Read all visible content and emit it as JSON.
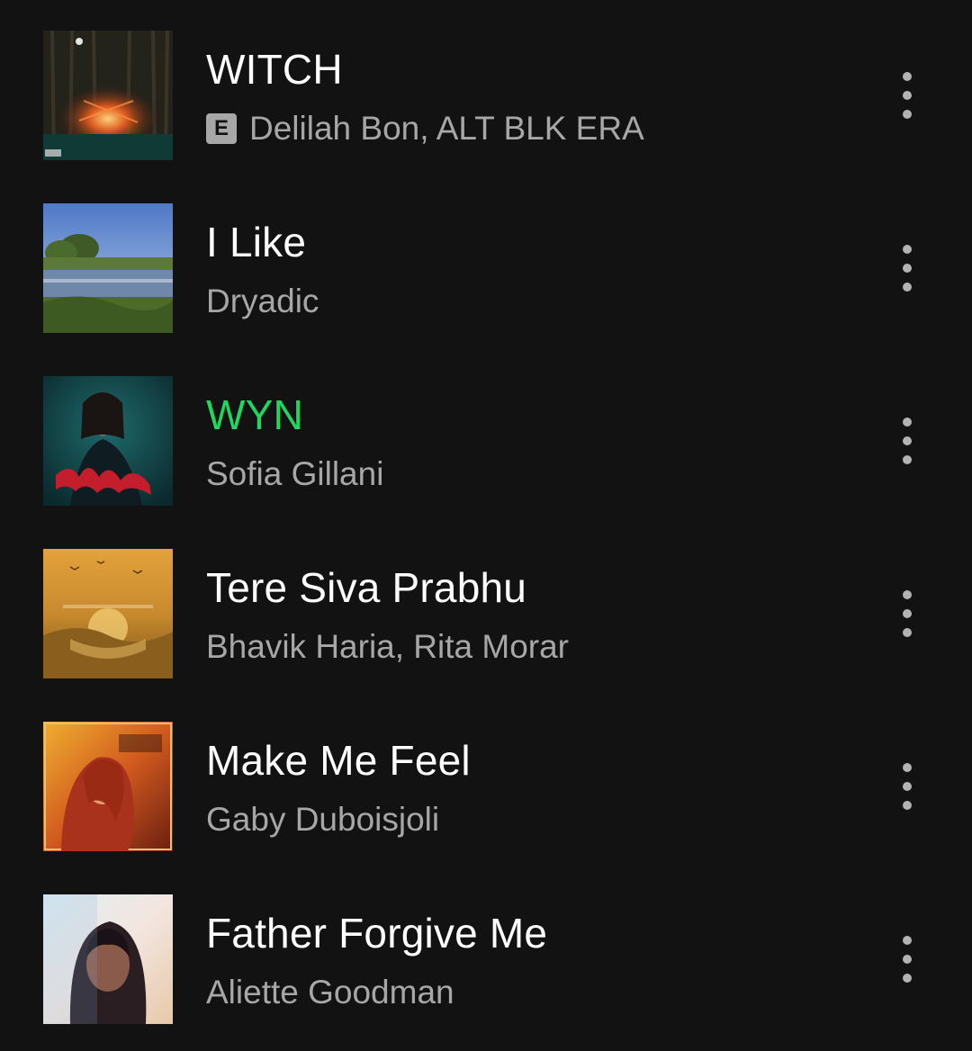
{
  "colors": {
    "background": "#121212",
    "title": "#ffffff",
    "playing": "#1ed760",
    "subtitle": "#a7a7a7"
  },
  "tracks": [
    {
      "title": "WITCH",
      "artists": "Delilah Bon, ALT BLK ERA",
      "explicit": true,
      "explicit_label": "E",
      "playing": false
    },
    {
      "title": "I Like",
      "artists": "Dryadic",
      "explicit": false,
      "playing": false
    },
    {
      "title": "WYN",
      "artists": "Sofia Gillani",
      "explicit": false,
      "playing": true
    },
    {
      "title": "Tere Siva Prabhu",
      "artists": "Bhavik Haria, Rita Morar",
      "explicit": false,
      "playing": false
    },
    {
      "title": "Make Me Feel",
      "artists": "Gaby Duboisjoli",
      "explicit": false,
      "playing": false
    },
    {
      "title": "Father Forgive Me",
      "artists": "Aliette Goodman",
      "explicit": false,
      "playing": false
    }
  ],
  "icons": {
    "more": "more-vertical-icon",
    "explicit": "explicit-icon"
  }
}
